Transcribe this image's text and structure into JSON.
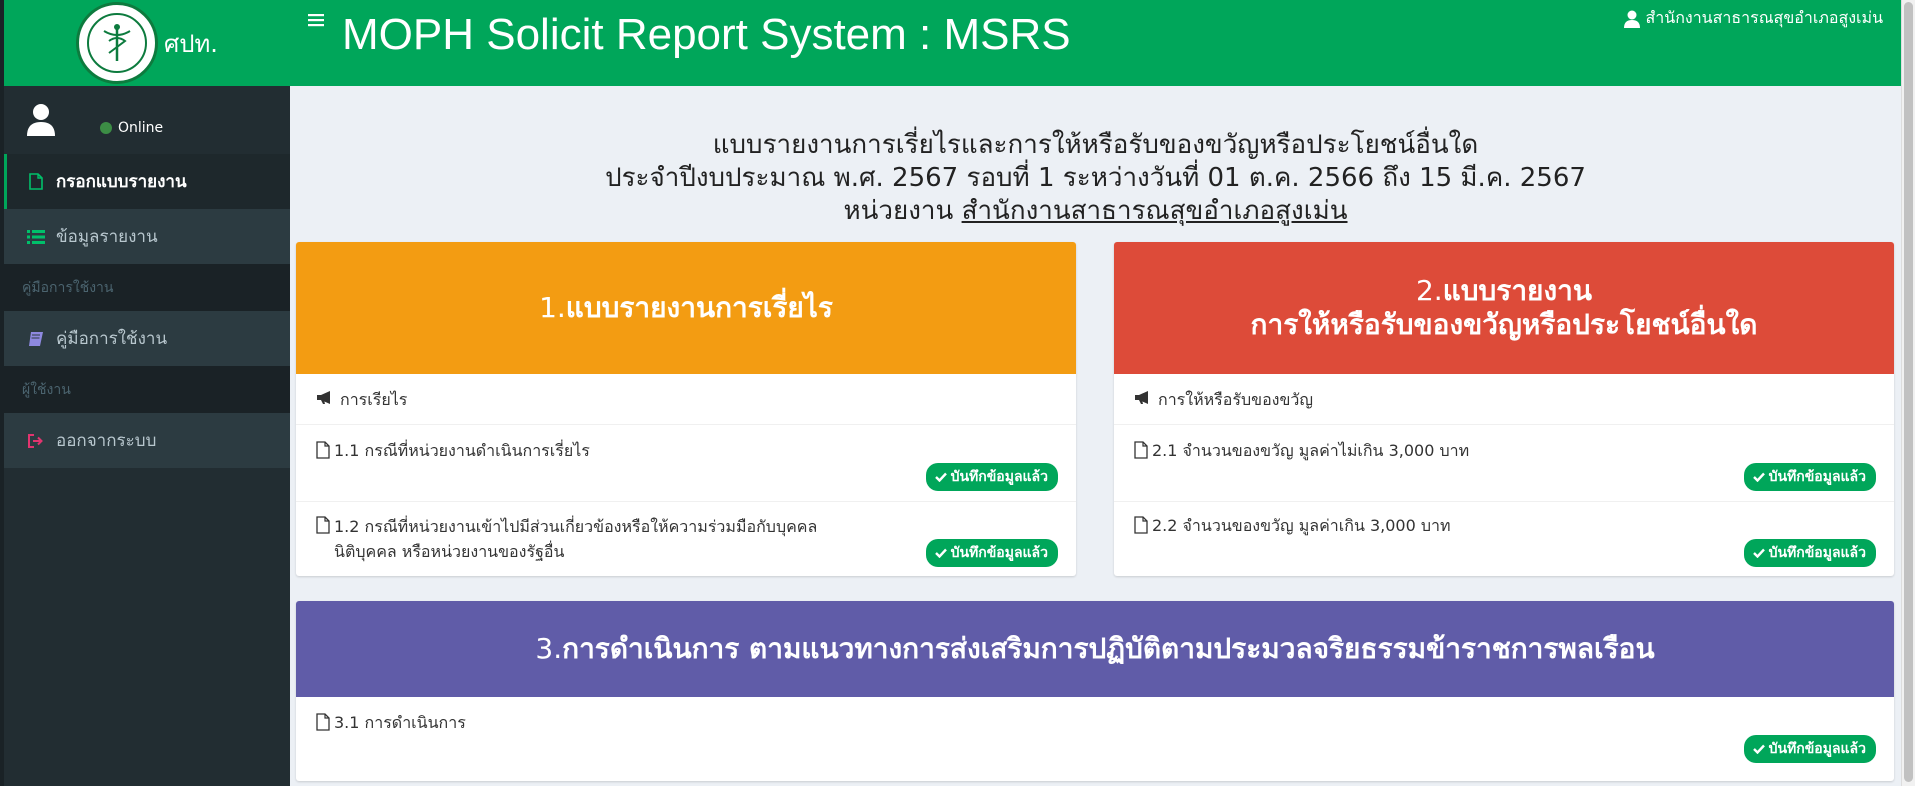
{
  "sidebar": {
    "logo_text": "ศปท.",
    "status": "Online",
    "items": [
      {
        "label": "กรอกแบบรายงาน",
        "icon": "file-icon"
      },
      {
        "label": "ข้อมูลรายงาน",
        "icon": "list-icon"
      }
    ],
    "header_manual": "คู่มือการใช้งาน",
    "manual_item": "คู่มือการใช้งาน",
    "header_user": "ผู้ใช้งาน",
    "logout_item": "ออกจากระบบ"
  },
  "header": {
    "title": "MOPH Solicit Report System : MSRS",
    "user": "สำนักงานสาธารณสุขอำเภอสูงเม่น"
  },
  "report": {
    "line1": "แบบรายงานการเรี่ยไรและการให้หรือรับของขวัญหรือประโยชน์อื่นใด",
    "line2": "ประจำปีงบประมาณ พ.ศ. 2567 รอบที่ 1 ระหว่างวันที่ 01 ต.ค. 2566 ถึง 15 มี.ค. 2567",
    "line3_prefix": "หน่วยงาน ",
    "line3_unit": "สำนักงานสาธารณสุขอำเภอสูงเม่น"
  },
  "panels": {
    "p1": {
      "num": "1.",
      "title": "แบบรายงานการเรี่ยไร",
      "color": "#f39c12",
      "subheader": "การเรียไร",
      "rows": [
        {
          "text": "1.1 กรณีที่หน่วยงานดำเนินการเรี่ยไร",
          "badge": "บันทึกข้อมูลแล้ว"
        },
        {
          "text1": "1.2 กรณีที่หน่วยงานเข้าไปมีส่วนเกี่ยวข้องหรือให้ความร่วมมือกับบุคคล",
          "text2": "นิติบุคคล หรือหน่วยงานของรัฐอื่น",
          "badge": "บันทึกข้อมูลแล้ว"
        }
      ]
    },
    "p2": {
      "num": "2.",
      "title1": "แบบรายงาน",
      "title2": "การให้หรือรับของขวัญหรือประโยชน์อื่นใด",
      "color": "#dd4b39",
      "subheader": "การให้หรือรับของขวัญ",
      "rows": [
        {
          "text": "2.1 จำนวนของขวัญ มูลค่าไม่เกิน 3,000 บาท",
          "badge": "บันทึกข้อมูลแล้ว"
        },
        {
          "text": "2.2 จำนวนของขวัญ มูลค่าเกิน 3,000 บาท",
          "badge": "บันทึกข้อมูลแล้ว"
        }
      ]
    },
    "p3": {
      "num": "3.",
      "title": "การดำเนินการ ตามแนวทางการส่งเสริมการปฏิบัติตามประมวลจริยธรรมข้าราชการพลเรือน",
      "color": "#605ca8",
      "rows": [
        {
          "text": "3.1 การดำเนินการ",
          "badge": "บันทึกข้อมูลแล้ว"
        }
      ]
    }
  }
}
